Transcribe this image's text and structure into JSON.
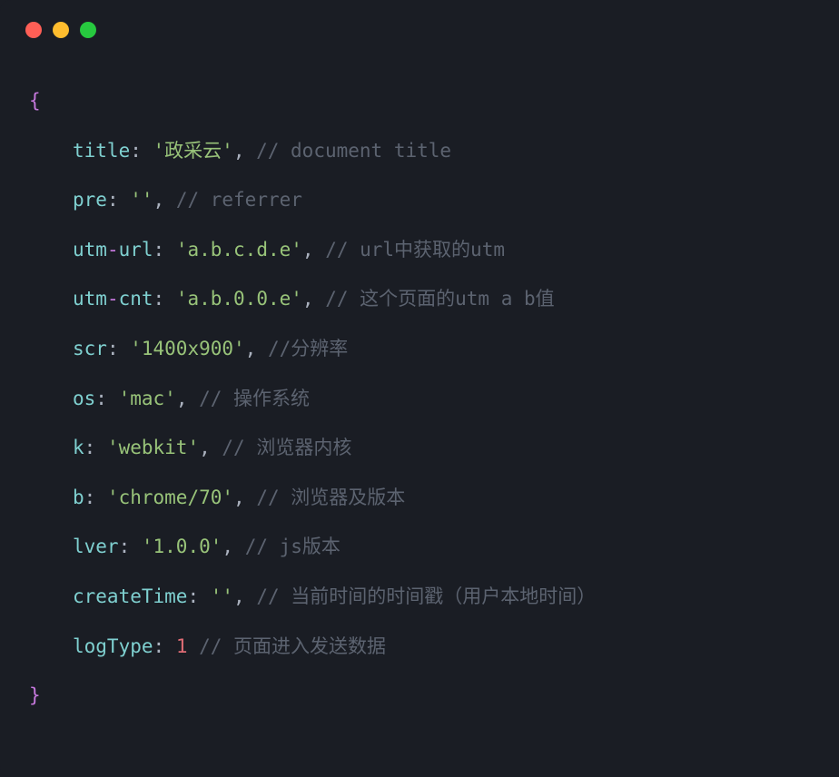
{
  "code": {
    "open_brace": "{",
    "close_brace": "}",
    "lines": [
      {
        "key": "title",
        "value": "'政采云'",
        "comment": "// document title"
      },
      {
        "key": "pre",
        "value": "''",
        "comment": "// referrer"
      },
      {
        "key_parts": [
          "utm",
          "-",
          "url"
        ],
        "value": "'a.b.c.d.e'",
        "comment": "// url中获取的utm"
      },
      {
        "key_parts": [
          "utm",
          "-",
          "cnt"
        ],
        "value": "'a.b.0.0.e'",
        "comment": "// 这个页面的utm a b值"
      },
      {
        "key": "scr",
        "value": "'1400x900'",
        "comment": "//分辨率"
      },
      {
        "key": "os",
        "value": "'mac'",
        "comment": "// 操作系统"
      },
      {
        "key": "k",
        "value": "'webkit'",
        "comment": "// 浏览器内核"
      },
      {
        "key": "b",
        "value": "'chrome/70'",
        "comment": "// 浏览器及版本"
      },
      {
        "key": "lver",
        "value": "'1.0.0'",
        "comment": "// js版本"
      },
      {
        "key": "createTime",
        "value": "''",
        "comment": "// 当前时间的时间戳（用户本地时间）"
      },
      {
        "key": "logType",
        "value_number": "1",
        "no_comma": true,
        "comment": "// 页面进入发送数据"
      }
    ]
  }
}
